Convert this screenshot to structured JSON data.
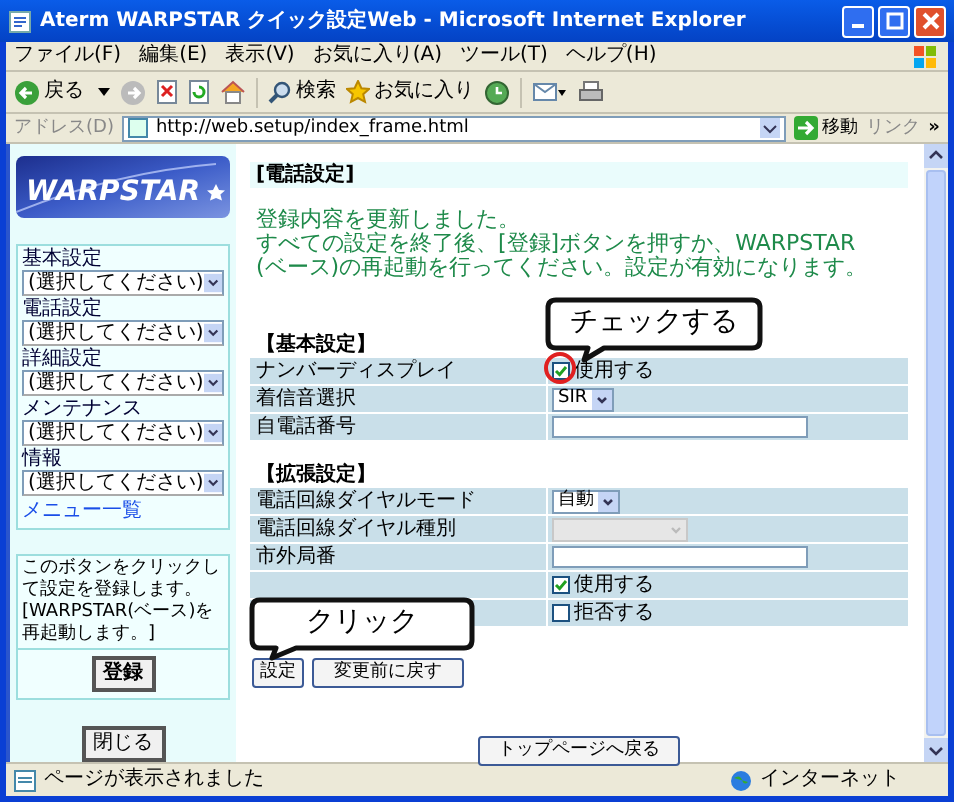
{
  "window": {
    "title": "Aterm WARPSTAR クイック設定Web - Microsoft Internet Explorer"
  },
  "menu": [
    "ファイル(F)",
    "編集(E)",
    "表示(V)",
    "お気に入り(A)",
    "ツール(T)",
    "ヘルプ(H)"
  ],
  "toolbar": {
    "back": "戻る",
    "search": "検索",
    "favorites": "お気に入り"
  },
  "address": {
    "label": "アドレス(D)",
    "url": "http://web.setup/index_frame.html",
    "go": "移動",
    "links": "リンク",
    "more": "»"
  },
  "sidebar": {
    "logo": "WARPSTAR",
    "sections": [
      {
        "label": "基本設定",
        "value": "(選択してください)"
      },
      {
        "label": "電話設定",
        "value": "(選択してください)"
      },
      {
        "label": "詳細設定",
        "value": "(選択してください)"
      },
      {
        "label": "メンテナンス",
        "value": "(選択してください)"
      },
      {
        "label": "情報",
        "value": "(選択してください)"
      }
    ],
    "menu_link": "メニュー一覧",
    "note": "このボタンをクリックして設定を登録します。[WARPSTAR(ベース)を再起動します。]",
    "register_button": "登録",
    "close_button": "閉じる"
  },
  "main": {
    "heading": "[電話設定]",
    "message": [
      "登録内容を更新しました。",
      "すべての設定を終了後、[登録]ボタンを押すか、WARPSTAR",
      "(ベース)の再起動を行ってください。設定が有効になります。"
    ],
    "groups": [
      {
        "title": "【基本設定】",
        "rows": [
          {
            "label": "ナンバーディスプレイ",
            "kind": "checkbox",
            "checked": true,
            "text": "使用する"
          },
          {
            "label": "着信音選択",
            "kind": "select",
            "value": "SIR",
            "disabled": false
          },
          {
            "label": "自電話番号",
            "kind": "text"
          }
        ]
      },
      {
        "title": "【拡張設定】",
        "rows": [
          {
            "label": "電話回線ダイヤルモード",
            "kind": "select",
            "value": "自動",
            "disabled": false
          },
          {
            "label": "電話回線ダイヤル種別",
            "kind": "select",
            "disabled": true
          },
          {
            "label": "市外局番",
            "kind": "text"
          },
          {
            "kind": "checkbox",
            "checked": true,
            "text": "使用する"
          },
          {
            "kind": "checkbox",
            "checked": false,
            "text": "拒否する"
          }
        ]
      }
    ],
    "buttons": [
      "設定",
      "変更前に戻す"
    ],
    "top_button": "トップページへ戻る"
  },
  "annotations": [
    {
      "text": "チェックする"
    },
    {
      "text": "クリック"
    }
  ],
  "status_bar": {
    "text": "ページが表示されました",
    "zone": "インターネット"
  }
}
